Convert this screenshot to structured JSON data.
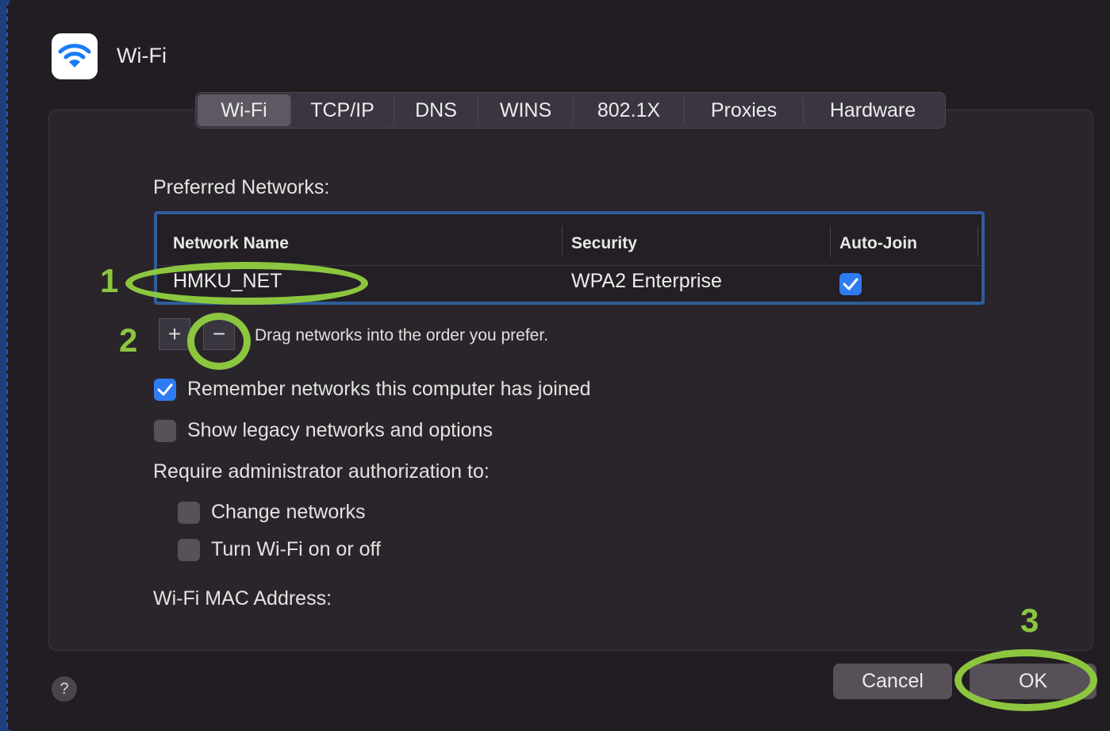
{
  "window": {
    "title": "Wi-Fi",
    "icon": "wifi-icon"
  },
  "tabs": [
    {
      "label": "Wi-Fi",
      "active": true
    },
    {
      "label": "TCP/IP",
      "active": false
    },
    {
      "label": "DNS",
      "active": false
    },
    {
      "label": "WINS",
      "active": false
    },
    {
      "label": "802.1X",
      "active": false
    },
    {
      "label": "Proxies",
      "active": false
    },
    {
      "label": "Hardware",
      "active": false
    }
  ],
  "preferred": {
    "title": "Preferred Networks:",
    "columns": [
      "Network Name",
      "Security",
      "Auto-Join"
    ],
    "rows": [
      {
        "name": "HMKU_NET",
        "security": "WPA2 Enterprise",
        "auto_join": true
      }
    ],
    "add_label": "+",
    "remove_label": "−",
    "hint": "Drag networks into the order you prefer."
  },
  "options": {
    "remember": {
      "label": "Remember networks this computer has joined",
      "checked": true
    },
    "legacy": {
      "label": "Show legacy networks and options",
      "checked": false
    },
    "require_title": "Require administrator authorization to:",
    "change_networks": {
      "label": "Change networks",
      "checked": false
    },
    "toggle_wifi": {
      "label": "Turn Wi-Fi on or off",
      "checked": false
    }
  },
  "mac_label": "Wi-Fi MAC Address:",
  "buttons": {
    "help": "?",
    "cancel": "Cancel",
    "ok": "OK"
  },
  "annotations": {
    "step1": "1",
    "step2": "2",
    "step3": "3",
    "color": "#8cc63f"
  },
  "colors": {
    "accent": "#2f7bf1",
    "annotation": "#8cc63f"
  }
}
